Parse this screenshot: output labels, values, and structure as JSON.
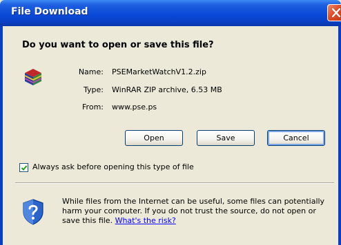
{
  "window": {
    "title": "File Download",
    "close_icon": "close-icon"
  },
  "dialog": {
    "heading": "Do you want to open or save this file?",
    "file": {
      "icon": "winrar-archive-icon",
      "name_label": "Name:",
      "name_value": "PSEMarketWatchV1.2.zip",
      "type_label": "Type:",
      "type_value": "WinRAR ZIP archive, 6.53 MB",
      "from_label": "From:",
      "from_value": "www.pse.ps"
    },
    "buttons": {
      "open": "Open",
      "save": "Save",
      "cancel": "Cancel"
    },
    "checkbox": {
      "label": "Always ask before opening this type of file",
      "checked": true
    },
    "warning": {
      "icon": "shield-question-icon",
      "text": "While files from the Internet can be useful, some files can potentially harm your computer. If you do not trust the source, do not open or save this file.",
      "link": "What's the risk?"
    }
  }
}
